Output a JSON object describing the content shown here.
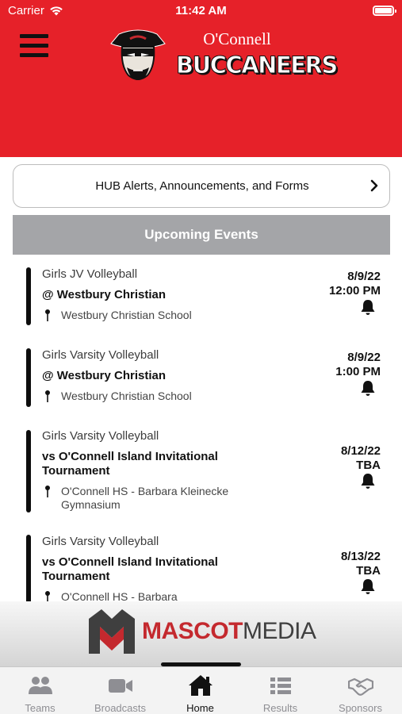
{
  "status_bar": {
    "carrier": "Carrier",
    "time": "11:42 AM"
  },
  "header": {
    "school": "O'Connell",
    "team": "BUCCANEERS",
    "brand_color": "#e62129"
  },
  "hub_button": {
    "label": "HUB Alerts, Announcements, and Forms"
  },
  "section_header": {
    "label": "Upcoming Events"
  },
  "events": [
    {
      "sport": "Girls JV Volleyball",
      "opponent": "@ Westbury Christian",
      "location": "Westbury Christian School",
      "date": "8/9/22",
      "time": "12:00 PM"
    },
    {
      "sport": "Girls Varsity Volleyball",
      "opponent": "@ Westbury Christian",
      "location": "Westbury Christian School",
      "date": "8/9/22",
      "time": "1:00 PM"
    },
    {
      "sport": "Girls Varsity Volleyball",
      "opponent": "vs O'Connell Island Invitational Tournament",
      "location": "O'Connell HS - Barbara Kleinecke Gymnasium",
      "date": "8/12/22",
      "time": "TBA"
    },
    {
      "sport": "Girls Varsity Volleyball",
      "opponent": "vs O'Connell Island Invitational Tournament",
      "location": "O'Connell HS - Barbara",
      "date": "8/13/22",
      "time": "TBA"
    }
  ],
  "ad": {
    "brand_a": "MASCOT",
    "brand_b": "MEDIA"
  },
  "tabs": [
    {
      "label": "Teams",
      "icon": "teams-icon"
    },
    {
      "label": "Broadcasts",
      "icon": "video-camera-icon"
    },
    {
      "label": "Home",
      "icon": "home-icon",
      "active": true
    },
    {
      "label": "Results",
      "icon": "list-icon"
    },
    {
      "label": "Sponsors",
      "icon": "handshake-icon"
    }
  ]
}
